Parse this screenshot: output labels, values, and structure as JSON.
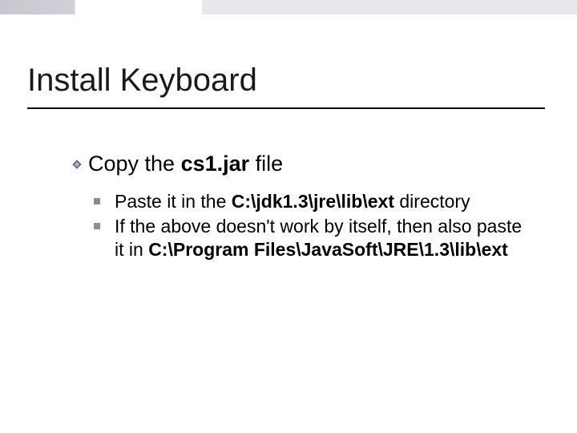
{
  "title": "Install Keyboard",
  "level1": {
    "prefix": "Copy the ",
    "bold": "cs1.jar",
    "suffix": " file"
  },
  "level2": [
    {
      "seg1": "Paste it in the ",
      "bold1": "C:\\jdk1.3\\jre\\lib\\ext",
      "seg2": " directory"
    },
    {
      "seg1": "If the above doesn't work by itself, then also paste it in ",
      "bold1": "C:\\Program Files\\JavaSoft\\JRE\\1.3\\lib\\ext",
      "seg2": ""
    }
  ]
}
